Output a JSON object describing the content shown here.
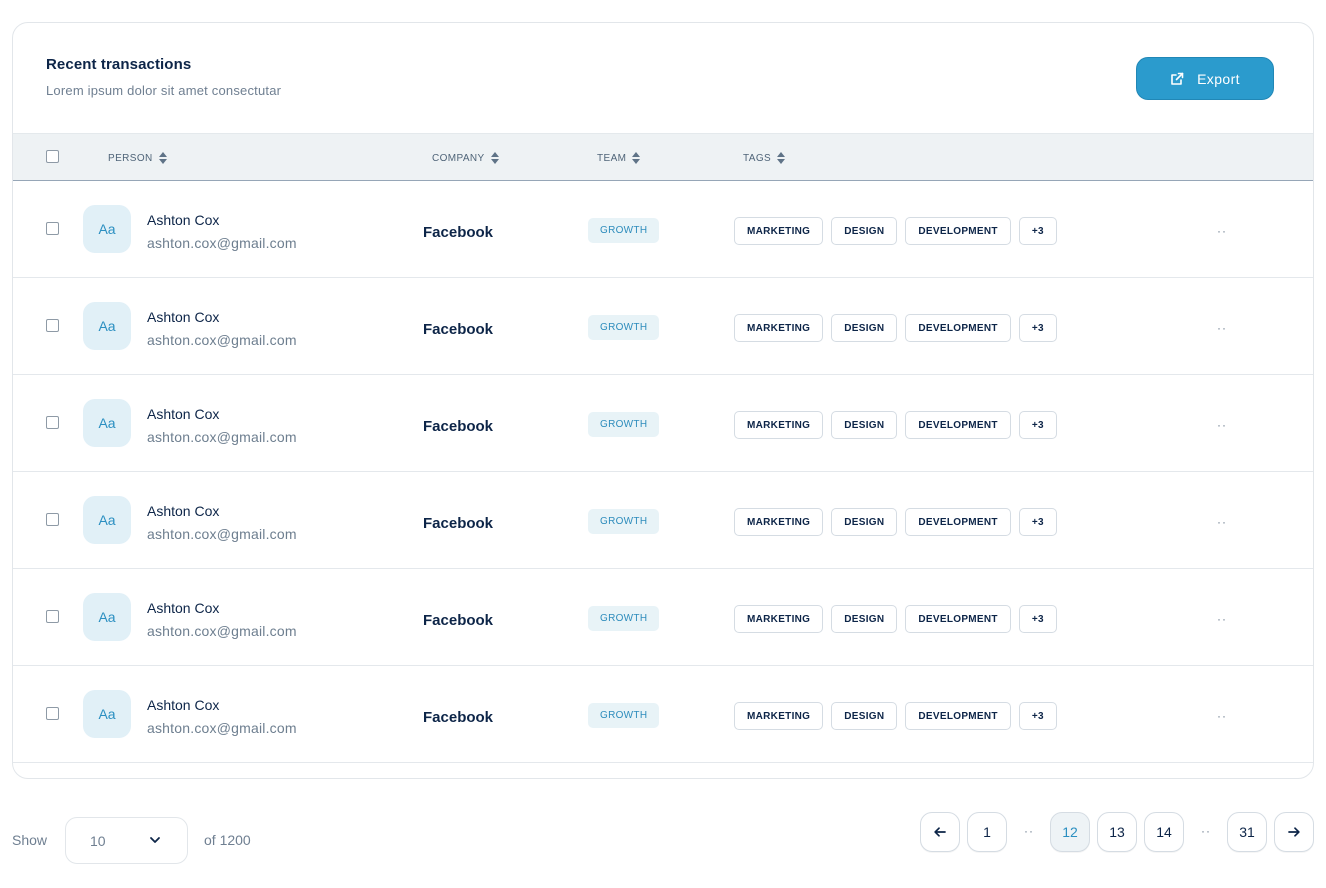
{
  "header": {
    "title": "Recent transactions",
    "subtitle": "Lorem ipsum dolor sit amet consectutar",
    "export_label": "Export",
    "export_icon": "external-link-icon"
  },
  "table": {
    "columns": [
      "PERSON",
      "COMPANY",
      "TEAM",
      "TAGS"
    ],
    "rows": [
      {
        "avatar": "Aa",
        "name": "Ashton Cox",
        "email": "ashton.cox@gmail.com",
        "company": "Facebook",
        "team": "GROWTH",
        "tags": [
          "MARKETING",
          "DESIGN",
          "DEVELOPMENT",
          "+3"
        ],
        "more": "··"
      },
      {
        "avatar": "Aa",
        "name": "Ashton Cox",
        "email": "ashton.cox@gmail.com",
        "company": "Facebook",
        "team": "GROWTH",
        "tags": [
          "MARKETING",
          "DESIGN",
          "DEVELOPMENT",
          "+3"
        ],
        "more": "··"
      },
      {
        "avatar": "Aa",
        "name": "Ashton Cox",
        "email": "ashton.cox@gmail.com",
        "company": "Facebook",
        "team": "GROWTH",
        "tags": [
          "MARKETING",
          "DESIGN",
          "DEVELOPMENT",
          "+3"
        ],
        "more": "··"
      },
      {
        "avatar": "Aa",
        "name": "Ashton Cox",
        "email": "ashton.cox@gmail.com",
        "company": "Facebook",
        "team": "GROWTH",
        "tags": [
          "MARKETING",
          "DESIGN",
          "DEVELOPMENT",
          "+3"
        ],
        "more": "··"
      },
      {
        "avatar": "Aa",
        "name": "Ashton Cox",
        "email": "ashton.cox@gmail.com",
        "company": "Facebook",
        "team": "GROWTH",
        "tags": [
          "MARKETING",
          "DESIGN",
          "DEVELOPMENT",
          "+3"
        ],
        "more": "··"
      },
      {
        "avatar": "Aa",
        "name": "Ashton Cox",
        "email": "ashton.cox@gmail.com",
        "company": "Facebook",
        "team": "GROWTH",
        "tags": [
          "MARKETING",
          "DESIGN",
          "DEVELOPMENT",
          "+3"
        ],
        "more": "··"
      }
    ]
  },
  "footer": {
    "show_label": "Show",
    "page_size": "10",
    "total_label": "of 1200",
    "pages": [
      "1",
      "12",
      "13",
      "14",
      "31"
    ],
    "current_page": "12",
    "ellipsis": "··"
  },
  "colors": {
    "accent": "#2b9bcd",
    "text": "#0d2548",
    "muted": "#6f7f91",
    "header_bg": "#eef2f4"
  }
}
